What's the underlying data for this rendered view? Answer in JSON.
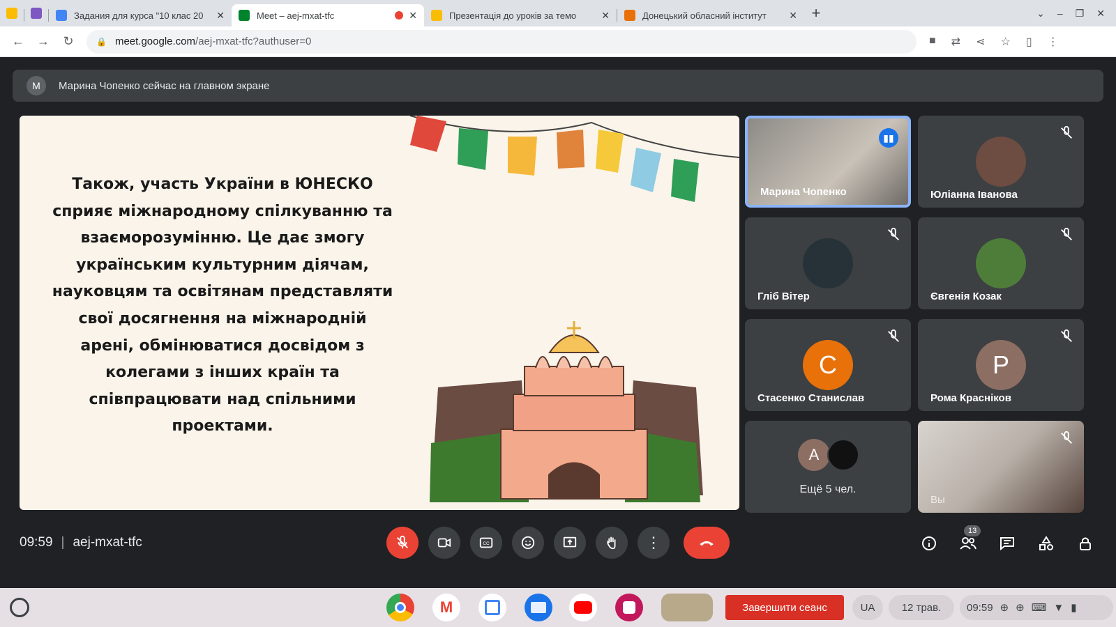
{
  "browser": {
    "tabs": [
      {
        "title": "Задания для курса \"10 клас 20",
        "favicon_color": "#4285f4"
      },
      {
        "title": "Meet – aej-mxat-tfc",
        "favicon_color": "#00832d",
        "active": true,
        "recording": true
      },
      {
        "title": "Презентація до уроків за темо",
        "favicon_color": "#fbbc04"
      },
      {
        "title": "Донецький обласний інститут",
        "favicon_color": "#e8710a"
      }
    ],
    "url_host": "meet.google.com",
    "url_path": "/aej-mxat-tfc?authuser=0"
  },
  "meet": {
    "banner": {
      "avatar_letter": "M",
      "text": "Марина Чопенко сейчас на главном экране"
    },
    "slide": {
      "text": "Також, участь України в ЮНЕСКО сприяє міжнародному спілкуванню та взаєморозумінню. Це дає змогу українським культурним діячам, науковцям та освітянам представляти свої досягнення на міжнародній арені, обмінюватися досвідом з колегами з інших країн та співпрацювати над спільними проектами."
    },
    "participants": [
      {
        "name": "Марина Чопенко",
        "speaking": true
      },
      {
        "name": "Юліанна Іванова",
        "muted": true
      },
      {
        "name": "Гліб Вітер",
        "muted": true
      },
      {
        "name": "Євгенія Козак",
        "muted": true
      },
      {
        "name": "Стасенко Станислав",
        "letter": "С",
        "color": "#e8710a",
        "muted": true
      },
      {
        "name": "Рома Красніков",
        "letter": "Р",
        "color": "#8d6e63",
        "muted": true
      }
    ],
    "more": {
      "letter": "A",
      "label": "Ещё 5 чел."
    },
    "self_label": "Вы",
    "time": "09:59",
    "code": "aej-mxat-tfc",
    "participants_count": "13"
  },
  "shelf": {
    "end_session": "Завершити сеанс",
    "lang": "UA",
    "date": "12 трав.",
    "time": "09:59"
  }
}
